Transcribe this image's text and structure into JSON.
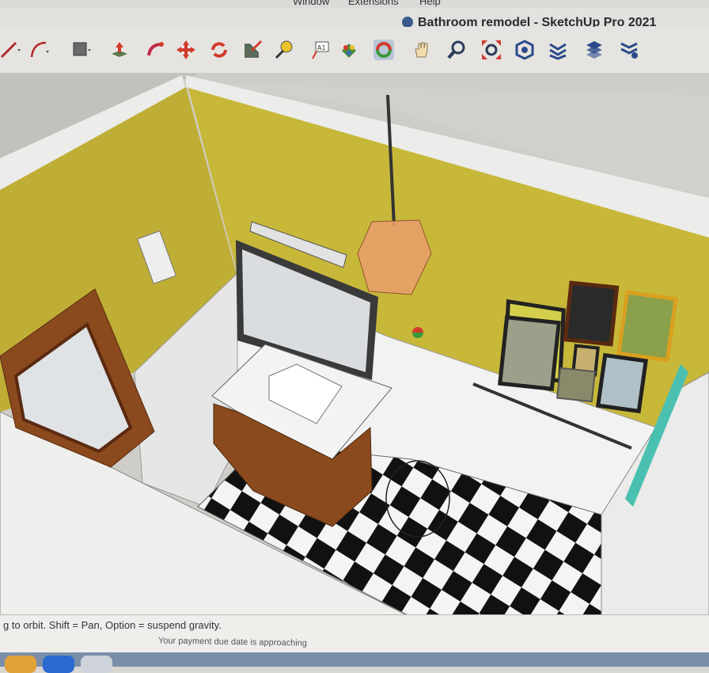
{
  "menubar": {
    "items": [
      "Window",
      "Extensions",
      "Help"
    ]
  },
  "window": {
    "title": "Bathroom remodel - SketchUp Pro 2021"
  },
  "toolbar": {
    "tools": [
      "line-icon",
      "arc-icon",
      "rectangle-icon",
      "push-pull-icon",
      "follow-me-icon",
      "move-icon",
      "rotate-icon",
      "scale-icon",
      "tape-measure-icon",
      "text-icon",
      "paint-bucket-icon",
      "orbit-icon",
      "pan-icon",
      "zoom-icon",
      "zoom-extents-icon",
      "components-icon",
      "sections-icon",
      "layers-icon",
      "scenes-icon"
    ],
    "text_tool_label": "A1"
  },
  "status": {
    "hint": "g to orbit. Shift = Pan, Option = suspend gravity.",
    "notice": "Your payment due date is approaching"
  },
  "colors": {
    "wall": "#c8b83a",
    "wainscot": "#f2f2f2",
    "floor_dark": "#111111",
    "floor_light": "#f4f4f4",
    "vanity": "#8a4a1e",
    "accent": "#3a5a8c"
  }
}
